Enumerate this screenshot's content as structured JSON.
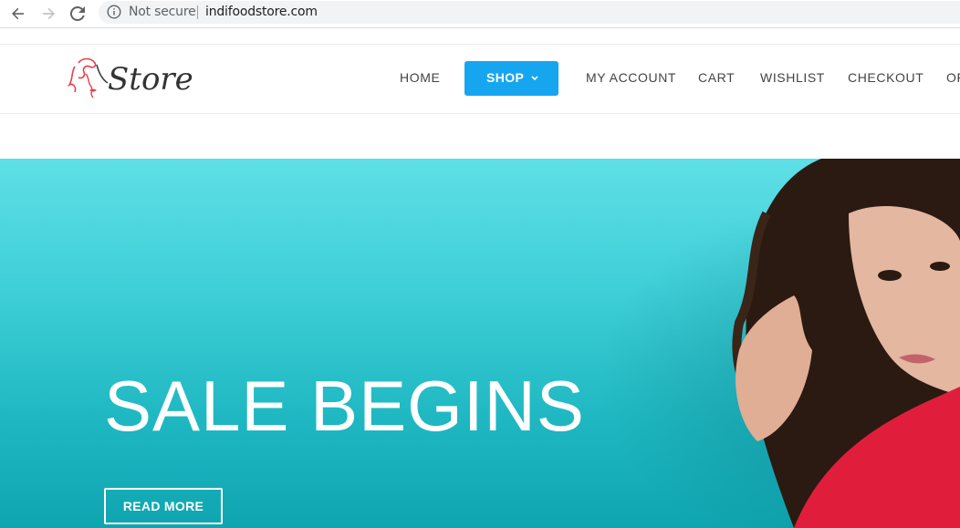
{
  "browser": {
    "security_label": "Not secure",
    "url": "indifoodstore.com"
  },
  "site": {
    "logo_text": "Store",
    "menu": {
      "home": "HOME",
      "shop": "SHOP",
      "my_account": "MY ACCOUNT",
      "cart": "CART",
      "wishlist": "WISHLIST",
      "checkout": "CHECKOUT",
      "overflow": "OF"
    }
  },
  "hero": {
    "title": "SALE BEGINS",
    "button_label": "READ MORE"
  },
  "colors": {
    "accent": "#16a6f0",
    "hero_bg": "#3fcfd8",
    "logo_red": "#e5404a"
  }
}
